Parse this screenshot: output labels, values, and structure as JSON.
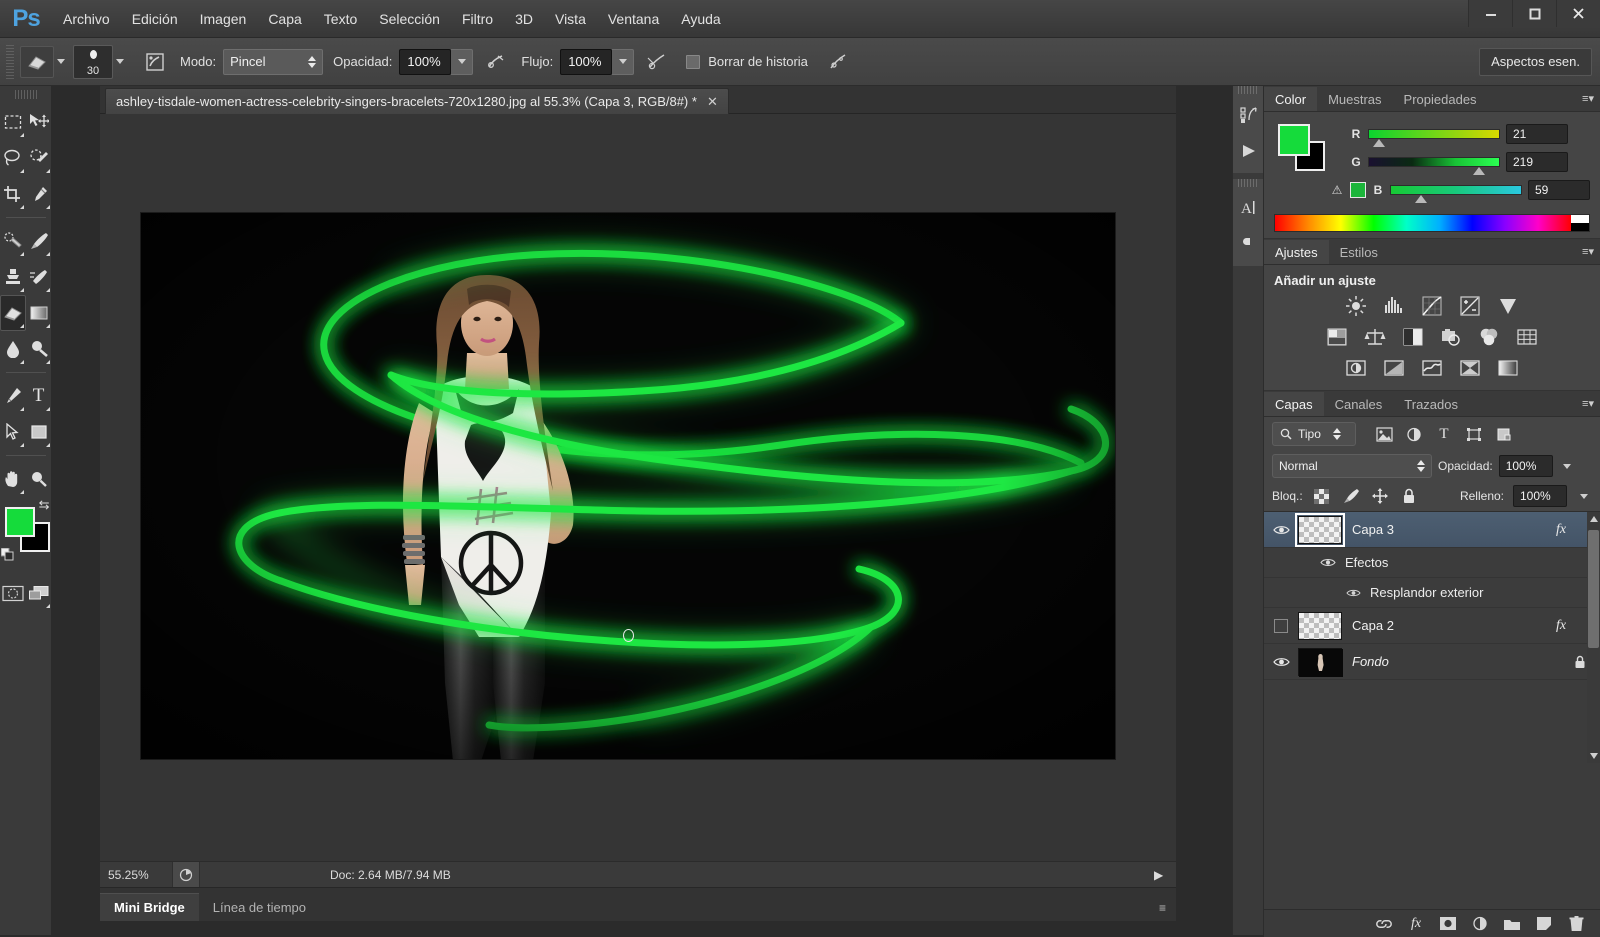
{
  "app": {
    "logo": "Ps",
    "workspace_button": "Aspectos esen."
  },
  "window_controls": {
    "minimize": "—",
    "maximize": "❐",
    "close": "✕"
  },
  "menu": [
    "Archivo",
    "Edición",
    "Imagen",
    "Capa",
    "Texto",
    "Selección",
    "Filtro",
    "3D",
    "Vista",
    "Ventana",
    "Ayuda"
  ],
  "options_bar": {
    "tool_icon": "eraser-icon",
    "brush_size": "30",
    "mode_label": "Modo:",
    "mode_value": "Pincel",
    "opacity_label": "Opacidad:",
    "opacity_value": "100%",
    "flow_label": "Flujo:",
    "flow_value": "100%",
    "erase_history_label": "Borrar de historia",
    "erase_history_checked": false,
    "airbrush_icon": "airbrush-icon",
    "pressure_opacity_icon": "pressure-opacity-icon",
    "pressure_size_icon": "pressure-size-icon",
    "toggle_brush_panel_icon": "brush-panel-icon"
  },
  "toolbar": {
    "tools": [
      {
        "name": "rectangular-marquee-tool",
        "has_flyout": true
      },
      {
        "name": "move-tool",
        "has_flyout": false
      },
      {
        "name": "lasso-tool",
        "has_flyout": true
      },
      {
        "name": "quick-selection-tool",
        "has_flyout": true
      },
      {
        "name": "crop-tool",
        "has_flyout": true
      },
      {
        "name": "eyedropper-tool",
        "has_flyout": true
      },
      {
        "name": "spot-healing-brush-tool",
        "has_flyout": true
      },
      {
        "name": "brush-tool",
        "has_flyout": true
      },
      {
        "name": "clone-stamp-tool",
        "has_flyout": true
      },
      {
        "name": "history-brush-tool",
        "has_flyout": true
      },
      {
        "name": "eraser-tool",
        "has_flyout": true,
        "active": true
      },
      {
        "name": "gradient-tool",
        "has_flyout": true
      },
      {
        "name": "blur-tool",
        "has_flyout": true
      },
      {
        "name": "dodge-tool",
        "has_flyout": true
      },
      {
        "name": "pen-tool",
        "has_flyout": true
      },
      {
        "name": "horizontal-type-tool",
        "has_flyout": true
      },
      {
        "name": "path-selection-tool",
        "has_flyout": true
      },
      {
        "name": "rectangle-tool",
        "has_flyout": true
      },
      {
        "name": "hand-tool",
        "has_flyout": true
      },
      {
        "name": "zoom-tool",
        "has_flyout": false
      }
    ],
    "foreground_color": "#15db3b",
    "background_color": "#000000",
    "quick_mask_name": "quick-mask-button",
    "screen_mode_name": "screen-mode-button"
  },
  "document": {
    "tab_title": "ashley-tisdale-women-actress-celebrity-singers-bracelets-720x1280.jpg al 55.3% (Capa 3, RGB/8#) *",
    "close_glyph": "✕"
  },
  "status_bar": {
    "zoom": "55.25%",
    "doc_info": "Doc: 2.64 MB/7.94 MB",
    "arrow_glyph": "▶"
  },
  "bottom_tabs": [
    {
      "label": "Mini Bridge",
      "active": true
    },
    {
      "label": "Línea de tiempo",
      "active": false
    }
  ],
  "icon_dock": [
    {
      "name": "history-icon"
    },
    {
      "name": "actions-play-icon"
    },
    {
      "name": "character-icon"
    },
    {
      "name": "paragraph-icon"
    }
  ],
  "color_panel": {
    "tabs": [
      {
        "label": "Color",
        "active": true
      },
      {
        "label": "Muestras",
        "active": false
      },
      {
        "label": "Propiedades",
        "active": false
      }
    ],
    "foreground": "#15db3b",
    "background": "#000000",
    "channels": [
      {
        "label": "R",
        "value": "21",
        "pos_pct": 8
      },
      {
        "label": "G",
        "value": "219",
        "pos_pct": 86
      },
      {
        "label": "B",
        "value": "59",
        "pos_pct": 23
      }
    ],
    "warning_glyph": "⚠",
    "warning_swatch": "#1bb43a"
  },
  "adjustments_panel": {
    "tabs": [
      {
        "label": "Ajustes",
        "active": true
      },
      {
        "label": "Estilos",
        "active": false
      }
    ],
    "title": "Añadir un ajuste",
    "rows": [
      [
        "brightness-contrast-icon",
        "levels-icon",
        "curves-icon",
        "exposure-icon",
        "vibrance-icon"
      ],
      [
        "hue-saturation-icon",
        "color-balance-icon",
        "black-white-icon",
        "photo-filter-icon",
        "channel-mixer-icon",
        "color-lookup-icon"
      ],
      [
        "invert-icon",
        "posterize-icon",
        "threshold-icon",
        "selective-color-icon",
        "gradient-map-icon"
      ]
    ]
  },
  "layers_panel": {
    "tabs": [
      {
        "label": "Capas",
        "active": true
      },
      {
        "label": "Canales",
        "active": false
      },
      {
        "label": "Trazados",
        "active": false
      }
    ],
    "filter_label": "Tipo",
    "filter_icons": [
      "pixel-filter-icon",
      "adjustment-filter-icon",
      "type-filter-icon",
      "shape-filter-icon",
      "smartobject-filter-icon"
    ],
    "blend_mode": "Normal",
    "opacity_label": "Opacidad:",
    "opacity_value": "100%",
    "lock_label": "Bloq.:",
    "lock_icons": [
      "lock-transparency-icon",
      "lock-image-icon",
      "lock-position-icon",
      "lock-all-icon"
    ],
    "fill_label": "Relleno:",
    "fill_value": "100%",
    "layers": [
      {
        "name": "Capa 3",
        "visible": true,
        "selected": true,
        "has_fx": true,
        "fx_label": "fx",
        "thumb": "transparent",
        "effects_group": "Efectos",
        "effects": [
          "Resplandor exterior"
        ]
      },
      {
        "name": "Capa 2",
        "visible": false,
        "selected": false,
        "has_fx": true,
        "fx_label": "fx",
        "thumb": "transparent"
      },
      {
        "name": "Fondo",
        "visible": true,
        "selected": false,
        "has_fx": false,
        "locked": true,
        "italic": true,
        "thumb": "photo"
      }
    ],
    "footer_icons": [
      "link-layers-icon",
      "add-layer-style-icon",
      "add-layer-mask-icon",
      "new-fill-adjustment-icon",
      "new-group-icon",
      "new-layer-icon",
      "delete-layer-icon"
    ]
  },
  "canvas": {
    "artwork_name": "neon-green-spiral-portrait",
    "background": "#050505",
    "neon_color": "#1fe33f",
    "zoom_percent": "55.25%",
    "cursor_name": "eraser-brush-cursor"
  }
}
